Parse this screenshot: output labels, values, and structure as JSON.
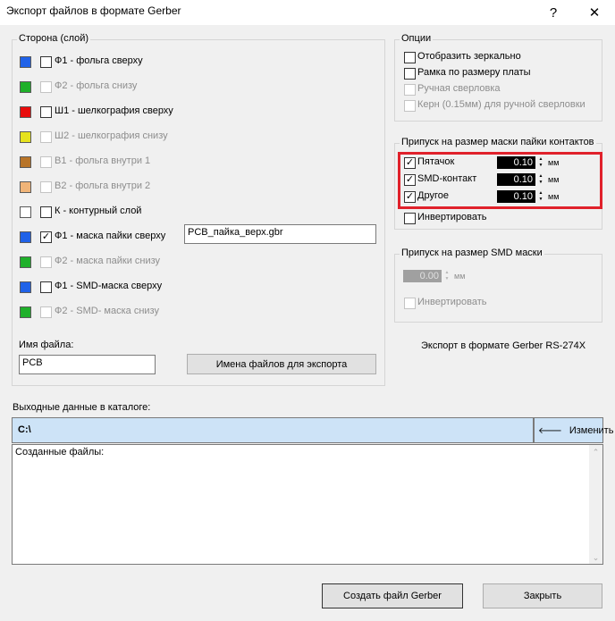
{
  "window": {
    "title": "Экспорт файлов в формате Gerber",
    "help": "?",
    "close": "✕"
  },
  "colors": {
    "top_copper": "#2062e8",
    "bottom_copper": "#1fb02a",
    "top_silk": "#e80c0c",
    "bottom_silk": "#e6e21e",
    "inner1": "#b87428",
    "inner2": "#f0b478",
    "outline": "#ffffff",
    "highlight": "#e0212b"
  },
  "side": {
    "title": "Сторона (слой)",
    "layers": [
      {
        "label": "Ф1 - фольга сверху",
        "checked": false,
        "enabled": true,
        "file": ""
      },
      {
        "label": "Ф2 - фольга снизу",
        "checked": false,
        "enabled": false,
        "file": ""
      },
      {
        "label": "Ш1 - шелкография сверху",
        "checked": false,
        "enabled": true,
        "file": ""
      },
      {
        "label": "Ш2 - шелкография снизу",
        "checked": false,
        "enabled": false,
        "file": ""
      },
      {
        "label": "В1 - фольга внутри 1",
        "checked": false,
        "enabled": false,
        "file": ""
      },
      {
        "label": "В2 - фольга внутри 2",
        "checked": false,
        "enabled": false,
        "file": ""
      },
      {
        "label": "К - контурный слой",
        "checked": false,
        "enabled": true,
        "file": ""
      },
      {
        "label": "Ф1 - маска пайки сверху",
        "checked": true,
        "enabled": true,
        "file": "PCB_пайка_верх.gbr"
      },
      {
        "label": "Ф2 - маска пайки снизу",
        "checked": false,
        "enabled": false,
        "file": ""
      },
      {
        "label": "Ф1 - SMD-маска сверху",
        "checked": false,
        "enabled": true,
        "file": ""
      },
      {
        "label": "Ф2 - SMD- маска снизу",
        "checked": false,
        "enabled": false,
        "file": ""
      }
    ],
    "filename_label": "Имя файла:",
    "filename_value": "PCB",
    "export_names_button": "Имена файлов для экспорта"
  },
  "options": {
    "title": "Опции",
    "items": [
      {
        "label": "Отобразить зеркально",
        "checked": false,
        "enabled": true
      },
      {
        "label": "Рамка по размеру платы",
        "checked": false,
        "enabled": true
      },
      {
        "label": "Ручная сверловка",
        "checked": false,
        "enabled": false
      },
      {
        "label": "Керн (0.15мм) для ручной сверловки",
        "checked": false,
        "enabled": false
      }
    ]
  },
  "solder_mask": {
    "title": "Припуск на размер маски пайки контактов",
    "rows": [
      {
        "label": "Пятачок",
        "checked": true,
        "value": "0.10",
        "unit": "мм"
      },
      {
        "label": "SMD-контакт",
        "checked": true,
        "value": "0.10",
        "unit": "мм"
      },
      {
        "label": "Другое",
        "checked": true,
        "value": "0.10",
        "unit": "мм"
      }
    ],
    "invert_label": "Инвертировать",
    "invert_checked": false
  },
  "smd_mask": {
    "title": "Припуск на размер SMD маски",
    "value": "0.00",
    "unit": "мм",
    "invert_label": "Инвертировать"
  },
  "format_note": "Экспорт в формате Gerber RS-274X",
  "output": {
    "label": "Выходные данные в каталоге:",
    "path": "C:\\",
    "change_button": "Изменить",
    "created_files_label": "Созданные файлы:"
  },
  "buttons": {
    "create": "Создать файл Gerber",
    "close": "Закрыть"
  }
}
